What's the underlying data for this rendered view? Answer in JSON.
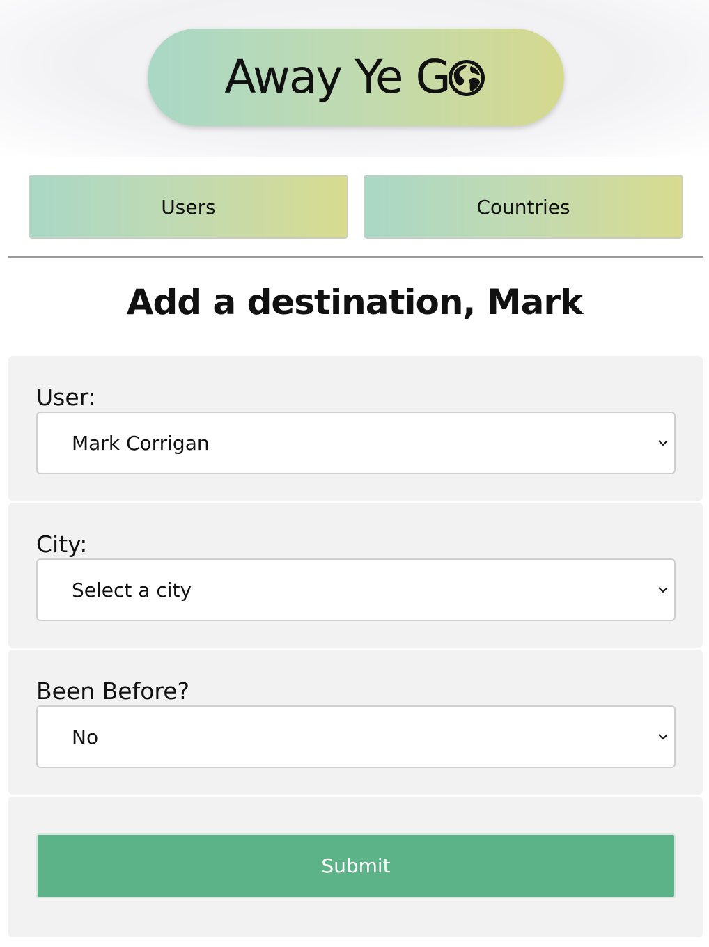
{
  "app": {
    "logo_text": "Away Ye G",
    "logo_icon": "globe-icon"
  },
  "nav": {
    "users_label": "Users",
    "countries_label": "Countries"
  },
  "main": {
    "title": "Add a destination, Mark"
  },
  "form": {
    "user": {
      "label": "User:",
      "selected_value": "Mark Corrigan"
    },
    "city": {
      "label": "City:",
      "selected_value": "Select a city"
    },
    "been_before": {
      "label": "Been Before?",
      "selected_value": "No"
    },
    "submit_label": "Submit"
  },
  "colors": {
    "brand_gradient_start": "#a9d8c6",
    "brand_gradient_end": "#d5d98e",
    "submit": "#5cb387",
    "panel_bg": "#f2f2f2"
  }
}
